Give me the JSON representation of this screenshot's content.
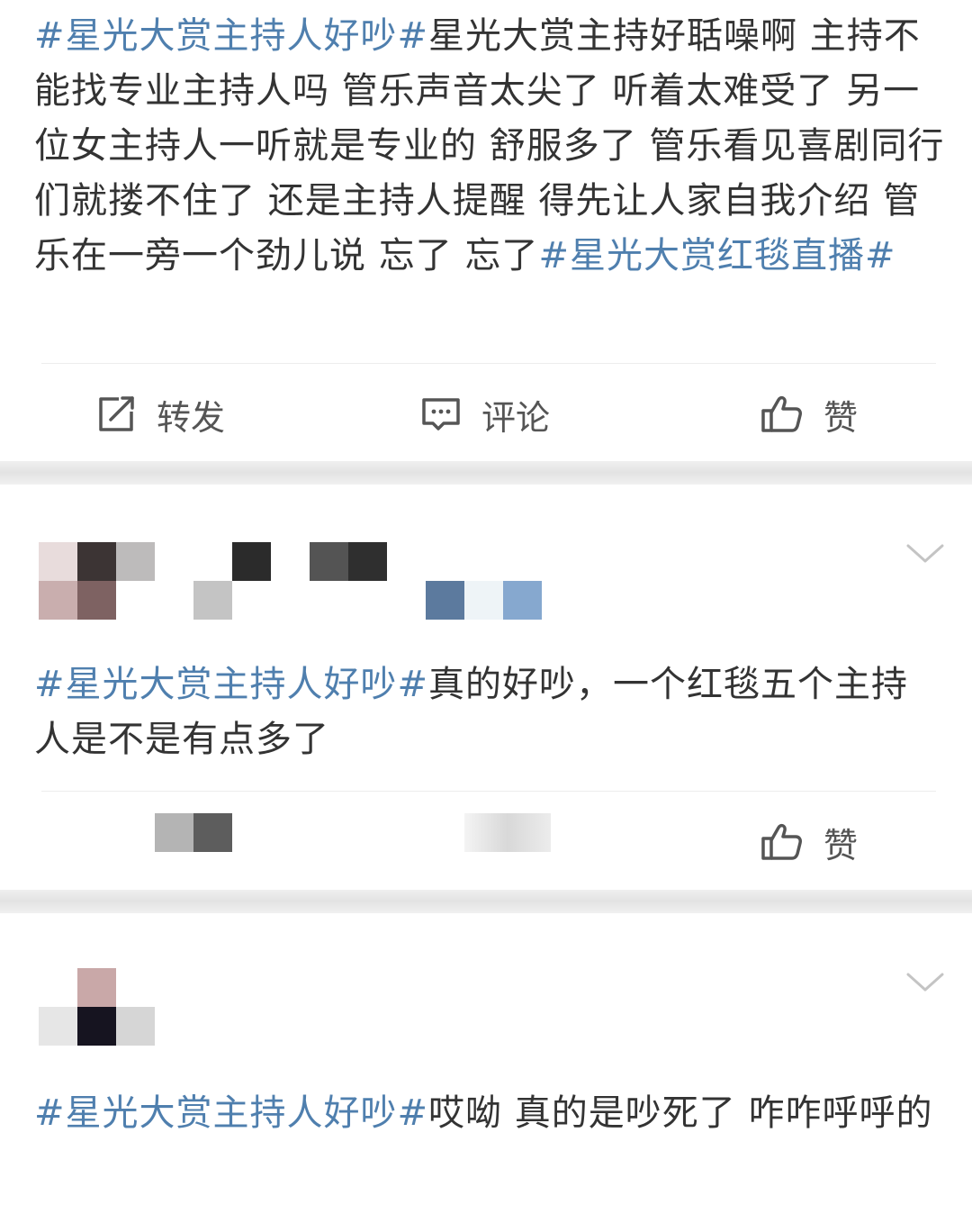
{
  "post": {
    "tag1": "#星光大赏主持人好吵#",
    "body": "星光大赏主持好聒噪啊 主持不能找专业主持人吗 管乐声音太尖了 听着太难受了 另一位女主持人一听就是专业的 舒服多了 管乐看见喜剧同行们就搂不住了 还是主持人提醒 得先让人家自我介绍 管乐在一旁一个劲儿说 忘了 忘了",
    "tag2": "#星光大赏红毯直播#"
  },
  "actions": {
    "repost_label": "转发",
    "comment_label": "评论",
    "like_label": "赞"
  },
  "comments": [
    {
      "tag": "#星光大赏主持人好吵#",
      "body": "真的好吵，一个红毯五个主持人是不是有点多了",
      "like_label": "赞"
    },
    {
      "tag": "#星光大赏主持人好吵#",
      "body": "哎呦 真的是吵死了 咋咋呼呼的"
    }
  ],
  "colors": {
    "hashtag": "#4f7fae",
    "text": "#333333",
    "icon": "#555555",
    "band": "#efefef"
  },
  "icons": [
    "repost-icon",
    "comment-icon",
    "like-icon",
    "chevron-down-icon"
  ]
}
